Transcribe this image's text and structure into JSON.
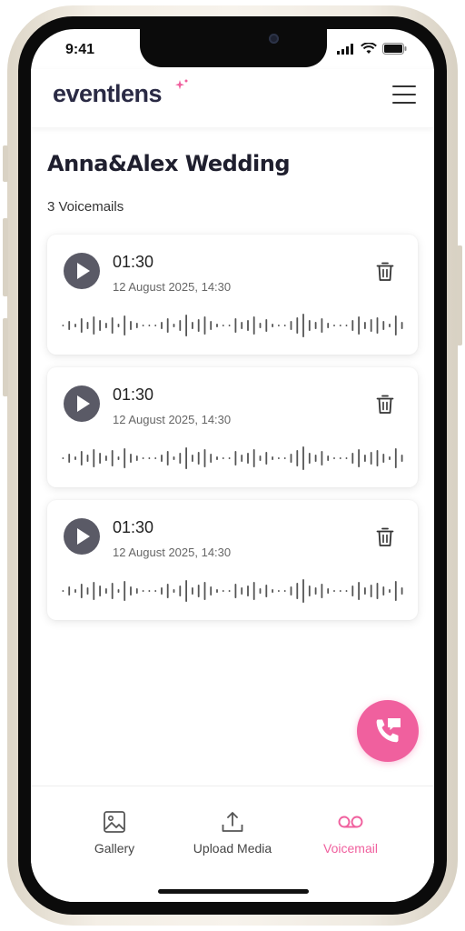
{
  "status_bar": {
    "time": "9:41"
  },
  "header": {
    "logo_text": "eventlens"
  },
  "event": {
    "title": "Anna&Alex Wedding",
    "voicemail_count": "3 Voicemails"
  },
  "voicemails": [
    {
      "duration": "01:30",
      "date": "12 August 2025, 14:30"
    },
    {
      "duration": "01:30",
      "date": "12 August 2025, 14:30"
    },
    {
      "duration": "01:30",
      "date": "12 August 2025, 14:30"
    }
  ],
  "bottom_nav": {
    "items": [
      {
        "label": "Gallery",
        "icon": "image-icon"
      },
      {
        "label": "Upload Media",
        "icon": "upload-icon"
      },
      {
        "label": "Voicemail",
        "icon": "voicemail-icon",
        "active": true
      }
    ]
  },
  "colors": {
    "accent": "#f0609e",
    "text_dark": "#1f1f2e",
    "play_button": "#5a5a66"
  }
}
